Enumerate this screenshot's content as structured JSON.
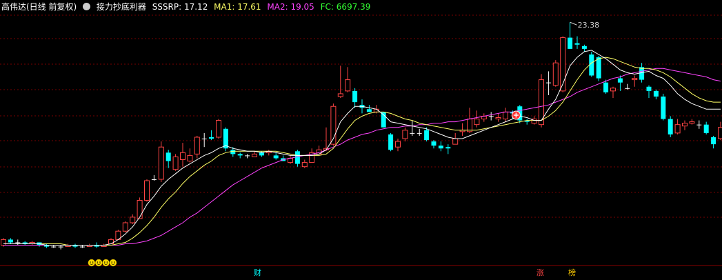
{
  "header": {
    "stock": "高伟达(日线 前复权)",
    "indicator_name": "接力抄底利器",
    "items": [
      {
        "label": "SSSRP: 17.12",
        "color": "#ffffff"
      },
      {
        "label": "MA1: 17.61",
        "color": "#ffff66"
      },
      {
        "label": "MA2: 19.05",
        "color": "#ff44ff"
      },
      {
        "label": "FC: 6697.39",
        "color": "#33ff33"
      }
    ]
  },
  "colors": {
    "up": "#ff4444",
    "down": "#00ffff",
    "flat": "#ffffff",
    "ma1": "#ffff66",
    "ma2": "#ff44ff",
    "sssrp": "#ffffff",
    "grid": "#7a0000"
  },
  "badges": [
    {
      "text": "财",
      "color": "#00ffff",
      "index": 35
    },
    {
      "text": "涨",
      "color": "#ff4444",
      "index": 75
    },
    {
      "text": "榜",
      "color": "#ffcc00",
      "index": 78
    }
  ],
  "icons": [
    "smiley-icon",
    "smiley-icon",
    "smiley-icon",
    "smiley-icon",
    "buy-signal-icon"
  ],
  "chart_data": {
    "type": "candlestick",
    "max_label": "23.38",
    "max_index": 79,
    "y_range": [
      6.0,
      24.0
    ],
    "candles": [
      {
        "o": 7.4,
        "h": 7.9,
        "l": 7.3,
        "c": 7.8
      },
      {
        "o": 7.8,
        "h": 7.9,
        "l": 7.5,
        "c": 7.6
      },
      {
        "o": 7.6,
        "h": 7.8,
        "l": 7.4,
        "c": 7.6
      },
      {
        "o": 7.6,
        "h": 7.7,
        "l": 7.4,
        "c": 7.5
      },
      {
        "o": 7.5,
        "h": 7.7,
        "l": 7.4,
        "c": 7.6
      },
      {
        "o": 7.6,
        "h": 7.6,
        "l": 7.3,
        "c": 7.4
      },
      {
        "o": 7.4,
        "h": 7.5,
        "l": 7.2,
        "c": 7.3
      },
      {
        "o": 7.3,
        "h": 7.4,
        "l": 7.2,
        "c": 7.3
      },
      {
        "o": 7.3,
        "h": 7.4,
        "l": 7.1,
        "c": 7.3
      },
      {
        "o": 7.3,
        "h": 7.5,
        "l": 7.3,
        "c": 7.4
      },
      {
        "o": 7.4,
        "h": 7.5,
        "l": 7.2,
        "c": 7.3
      },
      {
        "o": 7.3,
        "h": 7.4,
        "l": 7.2,
        "c": 7.3
      },
      {
        "o": 7.3,
        "h": 7.5,
        "l": 7.3,
        "c": 7.4
      },
      {
        "o": 7.4,
        "h": 7.6,
        "l": 7.2,
        "c": 7.3
      },
      {
        "o": 7.3,
        "h": 7.5,
        "l": 7.3,
        "c": 7.4
      },
      {
        "o": 7.5,
        "h": 7.9,
        "l": 7.5,
        "c": 7.8
      },
      {
        "o": 7.8,
        "h": 8.5,
        "l": 7.8,
        "c": 8.4
      },
      {
        "o": 8.4,
        "h": 9.1,
        "l": 8.3,
        "c": 9.0
      },
      {
        "o": 9.0,
        "h": 9.6,
        "l": 8.9,
        "c": 9.4
      },
      {
        "o": 9.3,
        "h": 10.8,
        "l": 9.3,
        "c": 10.6
      },
      {
        "o": 10.6,
        "h": 12.1,
        "l": 10.5,
        "c": 12.0
      },
      {
        "o": 12.1,
        "h": 12.4,
        "l": 12.0,
        "c": 12.1
      },
      {
        "o": 12.1,
        "h": 14.8,
        "l": 11.9,
        "c": 14.4
      },
      {
        "o": 14.0,
        "h": 14.2,
        "l": 12.9,
        "c": 13.4
      },
      {
        "o": 12.8,
        "h": 13.9,
        "l": 12.7,
        "c": 13.7
      },
      {
        "o": 13.5,
        "h": 14.7,
        "l": 13.0,
        "c": 14.0
      },
      {
        "o": 13.4,
        "h": 14.3,
        "l": 13.3,
        "c": 13.8
      },
      {
        "o": 13.9,
        "h": 15.2,
        "l": 13.6,
        "c": 15.1
      },
      {
        "o": 15.0,
        "h": 15.4,
        "l": 14.4,
        "c": 15.0
      },
      {
        "o": 15.1,
        "h": 15.6,
        "l": 14.9,
        "c": 15.0
      },
      {
        "o": 15.1,
        "h": 16.4,
        "l": 15.0,
        "c": 16.3
      },
      {
        "o": 15.7,
        "h": 15.8,
        "l": 14.1,
        "c": 14.3
      },
      {
        "o": 14.2,
        "h": 14.4,
        "l": 13.7,
        "c": 13.9
      },
      {
        "o": 13.9,
        "h": 14.0,
        "l": 13.6,
        "c": 13.8
      },
      {
        "o": 13.8,
        "h": 13.9,
        "l": 13.6,
        "c": 13.8
      },
      {
        "o": 13.7,
        "h": 14.1,
        "l": 13.7,
        "c": 13.9
      },
      {
        "o": 14.0,
        "h": 14.1,
        "l": 13.7,
        "c": 13.8
      },
      {
        "o": 14.0,
        "h": 14.2,
        "l": 13.8,
        "c": 14.1
      },
      {
        "o": 13.8,
        "h": 14.0,
        "l": 13.5,
        "c": 13.6
      },
      {
        "o": 13.6,
        "h": 13.8,
        "l": 13.4,
        "c": 13.4
      },
      {
        "o": 13.3,
        "h": 13.8,
        "l": 13.2,
        "c": 13.6
      },
      {
        "o": 14.1,
        "h": 14.2,
        "l": 13.0,
        "c": 13.2
      },
      {
        "o": 13.0,
        "h": 13.5,
        "l": 12.9,
        "c": 13.3
      },
      {
        "o": 13.3,
        "h": 14.3,
        "l": 13.3,
        "c": 14.0
      },
      {
        "o": 13.9,
        "h": 14.5,
        "l": 13.9,
        "c": 14.2
      },
      {
        "o": 14.2,
        "h": 15.8,
        "l": 14.1,
        "c": 14.3
      },
      {
        "o": 14.6,
        "h": 17.5,
        "l": 14.5,
        "c": 17.3
      },
      {
        "o": 18.0,
        "h": 20.2,
        "l": 17.9,
        "c": 18.2
      },
      {
        "o": 18.4,
        "h": 20.1,
        "l": 18.3,
        "c": 19.2
      },
      {
        "o": 18.4,
        "h": 18.6,
        "l": 17.2,
        "c": 17.6
      },
      {
        "o": 17.4,
        "h": 17.8,
        "l": 16.8,
        "c": 17.2
      },
      {
        "o": 17.1,
        "h": 17.4,
        "l": 16.9,
        "c": 16.9
      },
      {
        "o": 16.9,
        "h": 17.4,
        "l": 16.8,
        "c": 17.1
      },
      {
        "o": 16.9,
        "h": 16.9,
        "l": 15.8,
        "c": 15.8
      },
      {
        "o": 15.3,
        "h": 15.4,
        "l": 14.1,
        "c": 14.2
      },
      {
        "o": 14.4,
        "h": 15.0,
        "l": 14.1,
        "c": 14.8
      },
      {
        "o": 15.0,
        "h": 15.8,
        "l": 14.8,
        "c": 15.6
      },
      {
        "o": 15.4,
        "h": 16.3,
        "l": 15.2,
        "c": 15.4
      },
      {
        "o": 15.4,
        "h": 15.7,
        "l": 15.2,
        "c": 15.4
      },
      {
        "o": 15.6,
        "h": 15.8,
        "l": 14.8,
        "c": 14.9
      },
      {
        "o": 14.8,
        "h": 14.9,
        "l": 14.3,
        "c": 14.5
      },
      {
        "o": 14.5,
        "h": 14.8,
        "l": 14.1,
        "c": 14.3
      },
      {
        "o": 14.4,
        "h": 14.6,
        "l": 13.9,
        "c": 14.3
      },
      {
        "o": 14.6,
        "h": 15.4,
        "l": 14.6,
        "c": 15.0
      },
      {
        "o": 15.5,
        "h": 16.1,
        "l": 15.2,
        "c": 15.6
      },
      {
        "o": 15.5,
        "h": 17.2,
        "l": 15.4,
        "c": 16.4
      },
      {
        "o": 16.0,
        "h": 17.0,
        "l": 15.8,
        "c": 16.4
      },
      {
        "o": 16.4,
        "h": 16.8,
        "l": 16.2,
        "c": 16.6
      },
      {
        "o": 16.6,
        "h": 16.9,
        "l": 16.3,
        "c": 16.6
      },
      {
        "o": 16.4,
        "h": 16.8,
        "l": 16.2,
        "c": 16.5
      },
      {
        "o": 16.4,
        "h": 17.2,
        "l": 16.2,
        "c": 16.9
      },
      {
        "o": 16.9,
        "h": 17.0,
        "l": 16.4,
        "c": 16.8
      },
      {
        "o": 17.3,
        "h": 17.4,
        "l": 16.1,
        "c": 16.3
      },
      {
        "o": 16.3,
        "h": 16.4,
        "l": 16.0,
        "c": 16.2
      },
      {
        "o": 16.1,
        "h": 16.6,
        "l": 16.0,
        "c": 16.4
      },
      {
        "o": 16.0,
        "h": 19.6,
        "l": 15.8,
        "c": 19.2
      },
      {
        "o": 19.0,
        "h": 19.8,
        "l": 18.1,
        "c": 19.0
      },
      {
        "o": 18.8,
        "h": 20.6,
        "l": 18.7,
        "c": 20.4
      },
      {
        "o": 18.4,
        "h": 22.3,
        "l": 18.3,
        "c": 22.2
      },
      {
        "o": 22.2,
        "h": 23.3,
        "l": 21.4,
        "c": 21.4
      },
      {
        "o": 21.8,
        "h": 22.3,
        "l": 21.4,
        "c": 21.7
      },
      {
        "o": 21.6,
        "h": 21.7,
        "l": 21.2,
        "c": 21.4
      },
      {
        "o": 21.0,
        "h": 21.2,
        "l": 19.4,
        "c": 19.5
      },
      {
        "o": 20.8,
        "h": 20.9,
        "l": 19.1,
        "c": 19.3
      },
      {
        "o": 19.0,
        "h": 19.2,
        "l": 18.2,
        "c": 18.3
      },
      {
        "o": 18.4,
        "h": 18.7,
        "l": 17.9,
        "c": 18.6
      },
      {
        "o": 19.3,
        "h": 19.5,
        "l": 18.4,
        "c": 19.0
      },
      {
        "o": 18.6,
        "h": 18.9,
        "l": 18.5,
        "c": 18.6
      },
      {
        "o": 19.2,
        "h": 19.5,
        "l": 18.7,
        "c": 19.3
      },
      {
        "o": 20.1,
        "h": 20.4,
        "l": 19.0,
        "c": 19.2
      },
      {
        "o": 18.7,
        "h": 18.8,
        "l": 17.9,
        "c": 18.4
      },
      {
        "o": 18.4,
        "h": 18.5,
        "l": 17.8,
        "c": 18.0
      },
      {
        "o": 18.0,
        "h": 18.2,
        "l": 16.3,
        "c": 16.4
      },
      {
        "o": 16.4,
        "h": 16.6,
        "l": 15.1,
        "c": 15.3
      },
      {
        "o": 15.4,
        "h": 16.4,
        "l": 15.3,
        "c": 16.0
      },
      {
        "o": 15.9,
        "h": 16.3,
        "l": 15.6,
        "c": 16.1
      },
      {
        "o": 16.1,
        "h": 16.4,
        "l": 16.0,
        "c": 16.2
      },
      {
        "o": 16.0,
        "h": 16.3,
        "l": 15.7,
        "c": 16.0
      },
      {
        "o": 16.0,
        "h": 16.2,
        "l": 15.3,
        "c": 15.4
      },
      {
        "o": 15.1,
        "h": 15.2,
        "l": 14.3,
        "c": 14.6
      },
      {
        "o": 15.0,
        "h": 16.2,
        "l": 14.9,
        "c": 15.8
      }
    ],
    "series_sssrp": [
      7.5,
      7.5,
      7.5,
      7.5,
      7.5,
      7.5,
      7.4,
      7.4,
      7.4,
      7.4,
      7.4,
      7.4,
      7.4,
      7.4,
      7.4,
      7.5,
      7.8,
      8.2,
      8.7,
      9.4,
      10.3,
      10.9,
      11.6,
      12.1,
      12.5,
      12.9,
      13.2,
      13.5,
      13.8,
      14.0,
      14.3,
      14.5,
      14.3,
      14.2,
      14.1,
      14.1,
      14.0,
      14.1,
      14.0,
      13.9,
      13.8,
      13.8,
      13.8,
      13.8,
      13.9,
      14.2,
      15.0,
      16.2,
      16.8,
      17.3,
      17.3,
      17.2,
      17.1,
      16.7,
      16.2,
      16.1,
      16.0,
      15.9,
      15.8,
      15.7,
      15.5,
      15.3,
      15.1,
      15.0,
      15.0,
      15.2,
      15.4,
      15.6,
      15.8,
      16.0,
      16.2,
      16.4,
      16.6,
      16.5,
      16.3,
      16.3,
      17.1,
      17.8,
      18.9,
      20.2,
      20.8,
      21.2,
      21.3,
      21.0,
      20.7,
      20.3,
      19.9,
      19.7,
      19.6,
      19.7,
      19.8,
      19.5,
      19.3,
      18.8,
      18.2,
      17.8,
      17.5,
      17.3,
      17.1,
      17.1,
      17.1
    ],
    "series_ma1": [
      7.5,
      7.5,
      7.5,
      7.5,
      7.5,
      7.5,
      7.5,
      7.5,
      7.5,
      7.4,
      7.4,
      7.4,
      7.4,
      7.4,
      7.4,
      7.4,
      7.5,
      7.6,
      7.9,
      8.3,
      8.8,
      9.4,
      10.1,
      10.7,
      11.2,
      11.8,
      12.3,
      12.7,
      13.1,
      13.4,
      13.8,
      14.0,
      14.1,
      14.1,
      14.1,
      14.1,
      14.1,
      14.1,
      14.1,
      14.0,
      13.9,
      13.8,
      13.8,
      13.8,
      13.8,
      13.9,
      14.3,
      15.0,
      15.7,
      16.3,
      16.6,
      16.8,
      16.9,
      16.9,
      16.8,
      16.6,
      16.4,
      16.3,
      16.1,
      16.0,
      15.9,
      15.8,
      15.7,
      15.6,
      15.6,
      15.6,
      15.6,
      15.7,
      15.8,
      15.9,
      16.0,
      16.1,
      16.2,
      16.3,
      16.3,
      16.3,
      16.6,
      17.0,
      17.6,
      18.4,
      19.2,
      19.9,
      20.4,
      20.7,
      20.8,
      20.7,
      20.5,
      20.3,
      20.1,
      20.0,
      20.0,
      19.9,
      19.7,
      19.4,
      19.0,
      18.6,
      18.2,
      17.9,
      17.7,
      17.6,
      17.6
    ],
    "series_ma2": [
      7.4,
      7.4,
      7.4,
      7.4,
      7.4,
      7.4,
      7.4,
      7.4,
      7.4,
      7.4,
      7.4,
      7.4,
      7.4,
      7.4,
      7.4,
      7.4,
      7.4,
      7.5,
      7.5,
      7.6,
      7.7,
      7.9,
      8.1,
      8.4,
      8.7,
      9.0,
      9.4,
      9.7,
      10.1,
      10.5,
      10.9,
      11.3,
      11.7,
      12.0,
      12.3,
      12.6,
      12.9,
      13.1,
      13.3,
      13.5,
      13.6,
      13.7,
      13.8,
      13.9,
      14.0,
      14.2,
      14.4,
      14.6,
      14.9,
      15.1,
      15.3,
      15.4,
      15.6,
      15.7,
      15.8,
      15.8,
      15.9,
      15.9,
      16.0,
      16.0,
      16.1,
      16.1,
      16.2,
      16.2,
      16.3,
      16.4,
      16.5,
      16.6,
      16.7,
      16.8,
      16.9,
      16.9,
      17.0,
      17.1,
      17.2,
      17.3,
      17.4,
      17.6,
      17.8,
      18.0,
      18.3,
      18.5,
      18.7,
      18.9,
      19.1,
      19.3,
      19.4,
      19.6,
      19.7,
      19.8,
      19.9,
      20.0,
      20.0,
      19.9,
      19.8,
      19.7,
      19.6,
      19.5,
      19.4,
      19.2,
      19.1
    ]
  }
}
